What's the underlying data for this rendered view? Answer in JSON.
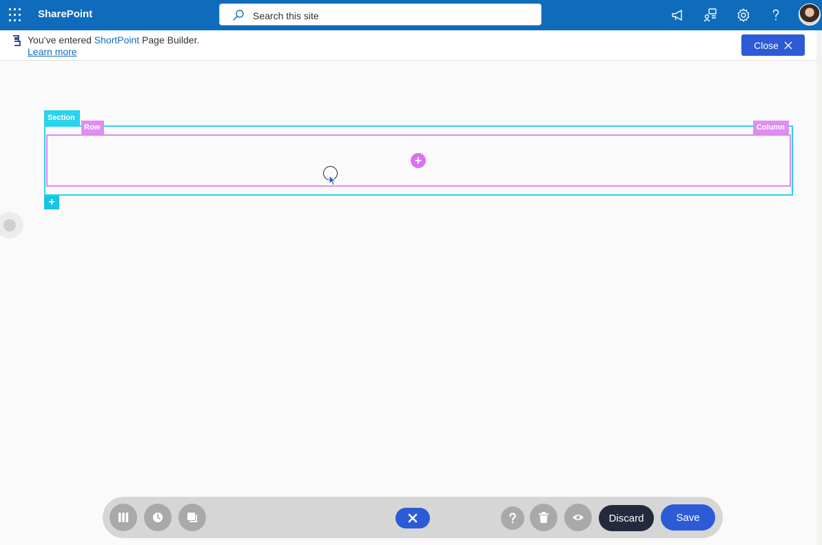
{
  "suitebar": {
    "app_name": "SharePoint",
    "search_placeholder": "Search this site",
    "icons": [
      "app-launcher-icon",
      "megaphone-icon",
      "share-network-icon",
      "gear-icon",
      "help-icon"
    ]
  },
  "notice": {
    "prefix": "You’ve entered ",
    "product": "ShortPoint",
    "suffix": " Page Builder.",
    "learn_more": "Learn more",
    "close_label": "Close"
  },
  "canvas": {
    "section_label": "Section",
    "row_label": "Row",
    "column_label": "Column",
    "add_element": "+",
    "add_section": "+"
  },
  "toolbar": {
    "discard_label": "Discard",
    "save_label": "Save",
    "left_icons": [
      "columns-icon",
      "history-icon",
      "copy-icon"
    ],
    "right_icons": [
      "help-icon",
      "trash-icon",
      "eye-icon"
    ]
  },
  "colors": {
    "suitebar": "#0f6cbd",
    "section": "#28d3ee",
    "row": "#de8ef2",
    "primary_button": "#2d5bd6",
    "discard_button": "#222a3b"
  }
}
